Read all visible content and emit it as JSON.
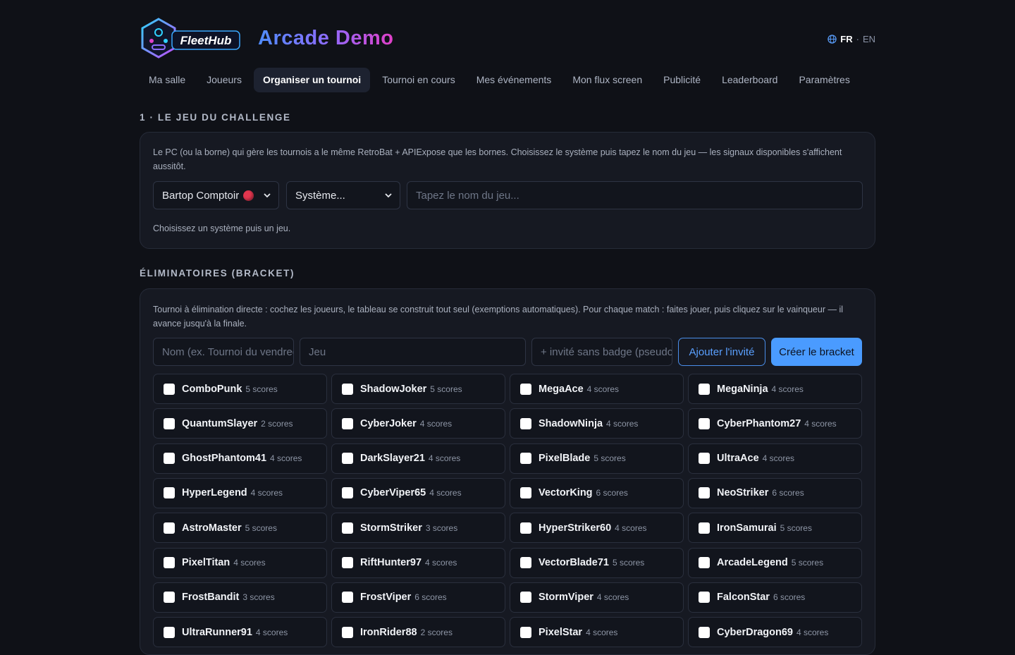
{
  "header": {
    "logo_text": "FleetHub",
    "title": "Arcade Demo",
    "lang_active": "FR",
    "lang_sep": "·",
    "lang_other": "EN"
  },
  "nav": [
    {
      "label": "Ma salle",
      "active": false
    },
    {
      "label": "Joueurs",
      "active": false
    },
    {
      "label": "Organiser un tournoi",
      "active": true
    },
    {
      "label": "Tournoi en cours",
      "active": false
    },
    {
      "label": "Mes événements",
      "active": false
    },
    {
      "label": "Mon flux screen",
      "active": false
    },
    {
      "label": "Publicité",
      "active": false
    },
    {
      "label": "Leaderboard",
      "active": false
    },
    {
      "label": "Paramètres",
      "active": false
    }
  ],
  "challenge": {
    "section_title": "1 · LE JEU DU CHALLENGE",
    "description": "Le PC (ou la borne) qui gère les tournois a le même RetroBat + APIExpose que les bornes. Choisissez le système puis tapez le nom du jeu — les signaux disponibles s'affichent aussitôt.",
    "machine_select": "Bartop Comptoir",
    "status_color": "#e2364f",
    "system_select": "Système...",
    "game_placeholder": "Tapez le nom du jeu...",
    "hint": "Choisissez un système puis un jeu."
  },
  "bracket": {
    "section_title": "ÉLIMINATOIRES (BRACKET)",
    "description": "Tournoi à élimination directe : cochez les joueurs, le tableau se construit tout seul (exemptions automatiques). Pour chaque match : faites jouer, puis cliquez sur le vainqueur — il avance jusqu'à la finale.",
    "name_placeholder": "Nom (ex. Tournoi du vendredi)",
    "game_placeholder": "Jeu",
    "guest_placeholder": "+ invité sans badge (pseudo)",
    "add_guest_label": "Ajouter l'invité",
    "create_label": "Créer le bracket",
    "score_suffix": "scores",
    "players": [
      {
        "name": "ComboPunk",
        "scores": 5
      },
      {
        "name": "ShadowJoker",
        "scores": 5
      },
      {
        "name": "MegaAce",
        "scores": 4
      },
      {
        "name": "MegaNinja",
        "scores": 4
      },
      {
        "name": "QuantumSlayer",
        "scores": 2
      },
      {
        "name": "CyberJoker",
        "scores": 4
      },
      {
        "name": "ShadowNinja",
        "scores": 4
      },
      {
        "name": "CyberPhantom27",
        "scores": 4
      },
      {
        "name": "GhostPhantom41",
        "scores": 4
      },
      {
        "name": "DarkSlayer21",
        "scores": 4
      },
      {
        "name": "PixelBlade",
        "scores": 5
      },
      {
        "name": "UltraAce",
        "scores": 4
      },
      {
        "name": "HyperLegend",
        "scores": 4
      },
      {
        "name": "CyberViper65",
        "scores": 4
      },
      {
        "name": "VectorKing",
        "scores": 6
      },
      {
        "name": "NeoStriker",
        "scores": 6
      },
      {
        "name": "AstroMaster",
        "scores": 5
      },
      {
        "name": "StormStriker",
        "scores": 3
      },
      {
        "name": "HyperStriker60",
        "scores": 4
      },
      {
        "name": "IronSamurai",
        "scores": 5
      },
      {
        "name": "PixelTitan",
        "scores": 4
      },
      {
        "name": "RiftHunter97",
        "scores": 4
      },
      {
        "name": "VectorBlade71",
        "scores": 5
      },
      {
        "name": "ArcadeLegend",
        "scores": 5
      },
      {
        "name": "FrostBandit",
        "scores": 3
      },
      {
        "name": "FrostViper",
        "scores": 6
      },
      {
        "name": "StormViper",
        "scores": 4
      },
      {
        "name": "FalconStar",
        "scores": 6
      },
      {
        "name": "UltraRunner91",
        "scores": 4
      },
      {
        "name": "IronRider88",
        "scores": 2
      },
      {
        "name": "PixelStar",
        "scores": 4
      },
      {
        "name": "CyberDragon69",
        "scores": 4
      }
    ]
  }
}
